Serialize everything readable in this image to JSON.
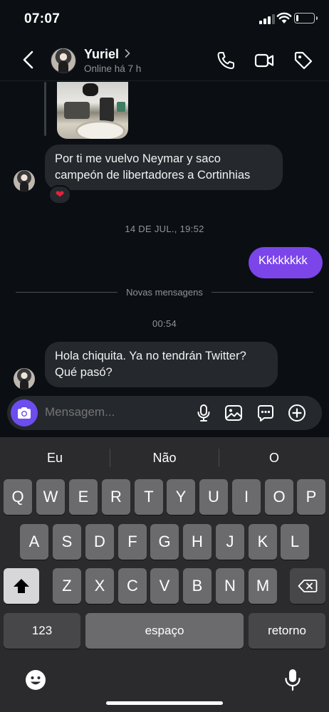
{
  "status_bar": {
    "time": "07:07",
    "battery_level": 0.15
  },
  "header": {
    "contact_name": "Yuriel",
    "presence": "Online há 7 h"
  },
  "messages": {
    "received_1": {
      "line1": "Por ti me vuelvo Neymar y saco",
      "line2": "campeón de libertadores  a Cortinhias",
      "reaction": "❤"
    },
    "timestamp_1": "14 DE JUL., 19:52",
    "sent_1": "Kkkkkkkk",
    "new_messages_divider": "Novas mensagens",
    "timestamp_2": "00:54",
    "received_2": {
      "line1": "Hola chiquita. Ya no tendrán Twitter?",
      "line2": "Qué pasó?"
    }
  },
  "composer": {
    "placeholder": "Mensagem..."
  },
  "keyboard": {
    "suggestions": [
      "Eu",
      "Não",
      "O"
    ],
    "row1": [
      "Q",
      "W",
      "E",
      "R",
      "T",
      "Y",
      "U",
      "I",
      "O",
      "P"
    ],
    "row2": [
      "A",
      "S",
      "D",
      "F",
      "G",
      "H",
      "J",
      "K",
      "L"
    ],
    "row3": [
      "Z",
      "X",
      "C",
      "V",
      "B",
      "N",
      "M"
    ],
    "numbers_key": "123",
    "space_key": "espaço",
    "return_key": "retorno"
  },
  "colors": {
    "accent": "#7b45ea",
    "background": "#0b0f13",
    "bubble_in": "#25282d"
  }
}
